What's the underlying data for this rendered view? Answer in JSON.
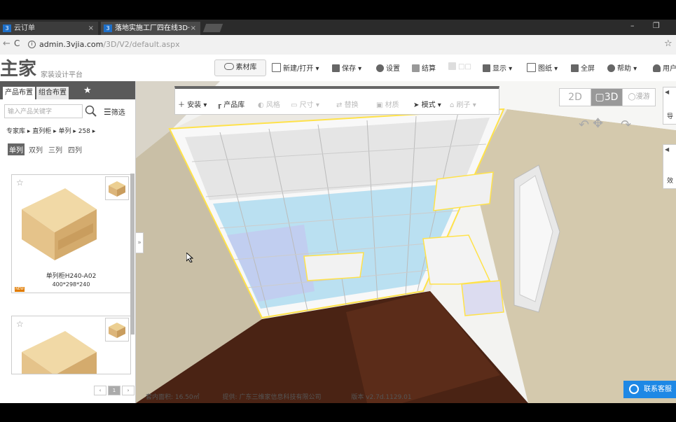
{
  "browser": {
    "tabs": [
      {
        "label": "云订单",
        "close": "×"
      },
      {
        "label": "落地实施工厂四在线3D·",
        "close": "×"
      }
    ],
    "window_min": "–",
    "window_restore": "❐",
    "address_host": "admin.3vjia.com",
    "address_path": "/3D/V2/default.aspx",
    "back": "←",
    "reload": "C",
    "bookmark": "☆"
  },
  "app": {
    "logo": "主家",
    "logo_sub": "家装设计平台",
    "material_button": "素材库",
    "header_actions": [
      {
        "label": "新建/打开 ▾"
      },
      {
        "label": "保存 ▾"
      },
      {
        "label": "设置"
      },
      {
        "label": "结算"
      },
      {
        "label": "□□"
      },
      {
        "label": "显示 ▾"
      },
      {
        "label": "图纸 ▾"
      },
      {
        "label": "全屏"
      },
      {
        "label": "帮助 ▾"
      },
      {
        "label": "用户"
      }
    ]
  },
  "left_panel": {
    "tabs": [
      "产品布置",
      "组合布置"
    ],
    "fav_star": "★",
    "search_placeholder": "输入产品关键字",
    "filter_label": "筛选",
    "breadcrumbs": "专家库 ▸   直列柜 ▸   单列 ▸   258 ▸",
    "columns": [
      "单列",
      "双列",
      "三列",
      "四列"
    ],
    "products": [
      {
        "name": "单列柜H240-A02",
        "dims": "400*298*240",
        "tag": "NEW"
      },
      {
        "name": "",
        "dims": "",
        "tag": ""
      }
    ],
    "pager": [
      "‹",
      "1",
      "›"
    ],
    "collapse": "»"
  },
  "toolbar": {
    "items": [
      {
        "label": "安装 ▾",
        "enabled": true
      },
      {
        "label": "产品库",
        "enabled": true
      },
      {
        "label": "风格",
        "enabled": false
      },
      {
        "label": "尺寸 ▾",
        "enabled": false
      },
      {
        "label": "替换",
        "enabled": false
      },
      {
        "label": "材质",
        "enabled": false
      },
      {
        "label": "模式 ▾",
        "enabled": true
      },
      {
        "label": "刷子 ▾",
        "enabled": false
      }
    ]
  },
  "view": {
    "mode_2d": "2D",
    "mode_3d": "3D",
    "mode_walk": "漫游",
    "active_mode": "3D"
  },
  "status": {
    "area": "套内面积: 16.50㎡",
    "provider": "提供: 广东三维家信息科技有限公司",
    "version": "版本 v2.7d.1129.01"
  },
  "support": "联系客服",
  "right_panel": [
    "导",
    "效"
  ]
}
